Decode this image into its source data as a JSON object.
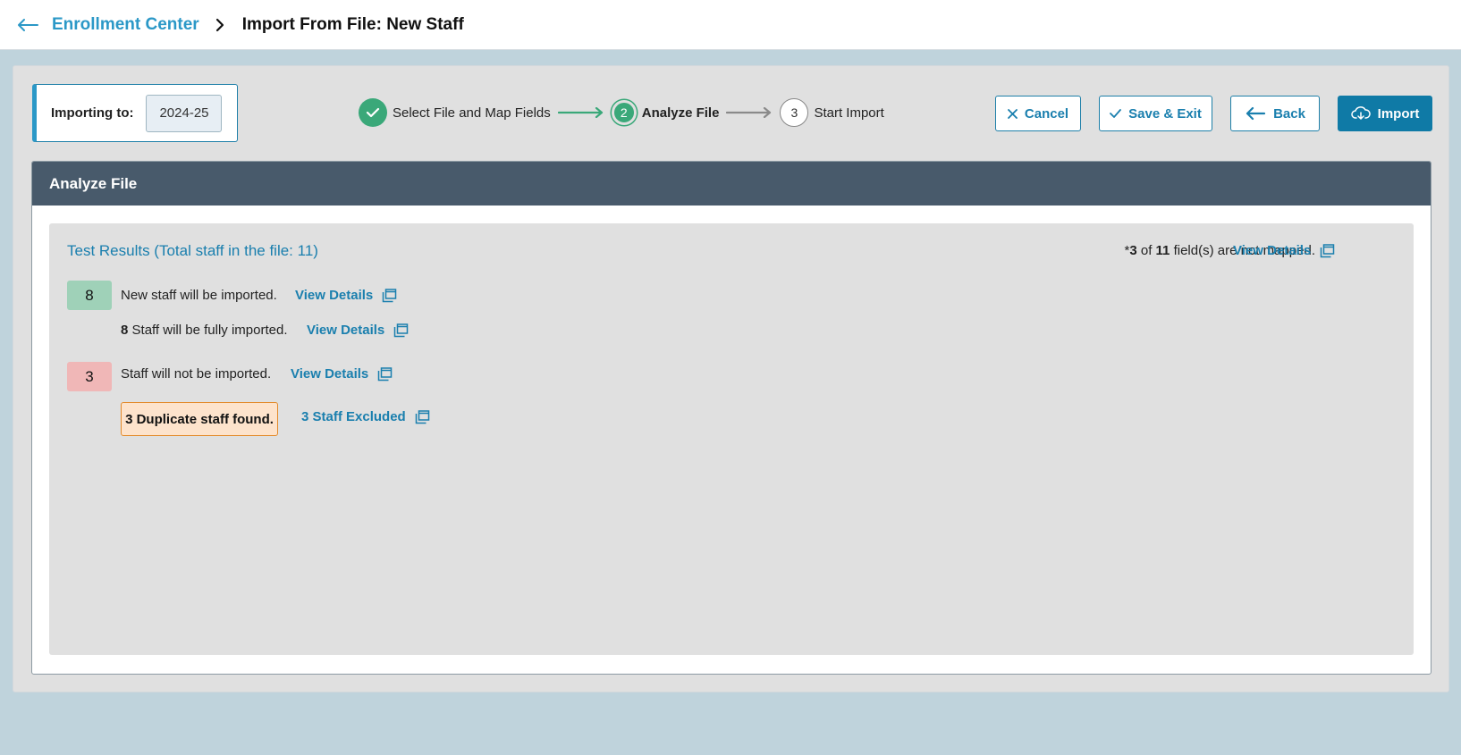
{
  "header": {
    "back_icon": "arrow-left-icon",
    "breadcrumb_parent": "Enrollment Center",
    "breadcrumb_current": "Import From File: New Staff"
  },
  "importing": {
    "label": "Importing to:",
    "year": "2024-25"
  },
  "steps": [
    {
      "label": "Select File and Map Fields",
      "state": "done"
    },
    {
      "number": "2",
      "label": "Analyze File",
      "state": "active"
    },
    {
      "number": "3",
      "label": "Start Import",
      "state": "todo"
    }
  ],
  "buttons": {
    "cancel": "Cancel",
    "save_exit": "Save & Exit",
    "back": "Back",
    "import": "Import"
  },
  "panel": {
    "title": "Analyze File"
  },
  "results": {
    "title": "Test Results (Total staff in the file: 11)",
    "mapped_prefix": "*",
    "mapped_count": "3",
    "mapped_of": "of",
    "mapped_total": "11",
    "mapped_suffix": "field(s) are not mapped.",
    "mapped_link": "View Details",
    "new_count": "8",
    "new_text": "New staff will be imported.",
    "new_link": "View Details",
    "full_count": "8",
    "full_text": "Staff will be fully imported.",
    "full_link": "View Details",
    "not_count": "3",
    "not_text": "Staff will not be imported.",
    "not_link": "View Details",
    "duplicate_text": "3 Duplicate staff found.",
    "excluded_link": "3 Staff Excluded"
  },
  "colors": {
    "accent": "#1a7fae",
    "header_bg": "#485a6b",
    "success": "#3aa879",
    "badge_green": "#9fd1b8",
    "badge_red": "#f0b7b7",
    "warning_border": "#e38a2a",
    "warning_bg": "#fde3cc"
  }
}
